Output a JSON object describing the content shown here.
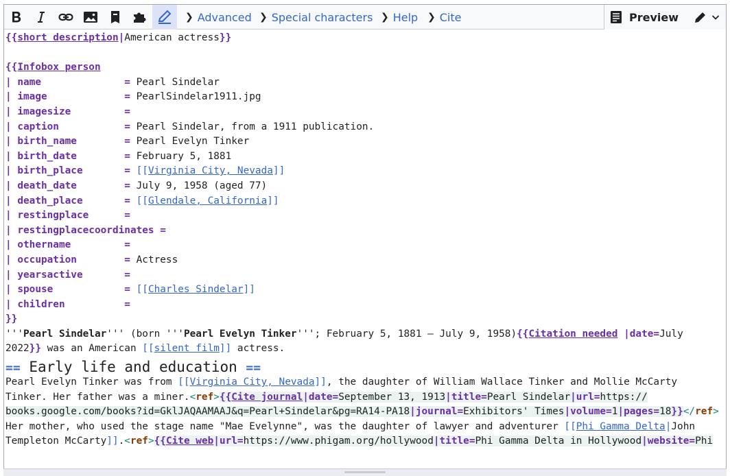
{
  "toolbar": {
    "bold_icon": "bold-icon",
    "italic_icon": "italic-icon",
    "link_icon": "link-icon",
    "image_icon": "image-icon",
    "reference_icon": "reference-icon",
    "puzzle_icon": "puzzle-icon",
    "edit_icon": "pencil-icon",
    "advanced": "Advanced",
    "special_characters": "Special characters",
    "help": "Help",
    "cite": "Cite",
    "preview": "Preview",
    "accent_color": "#3366cc"
  },
  "code": {
    "l1": {
      "open": "{{",
      "name": "short description",
      "pipe": "|",
      "value": "American actress",
      "close": "}}"
    },
    "l3": {
      "open": "{{",
      "name": "Infobox person"
    },
    "params": [
      {
        "key": "| name",
        "pad": "              ",
        "eq": "=",
        "value": " Pearl Sindelar"
      },
      {
        "key": "| image",
        "pad": "             ",
        "eq": "=",
        "value": " PearlSindelar1911.jpg"
      },
      {
        "key": "| imagesize",
        "pad": "         ",
        "eq": "=",
        "value": ""
      },
      {
        "key": "| caption",
        "pad": "           ",
        "eq": "=",
        "value": " Pearl Sindelar, from a 1911 publication."
      },
      {
        "key": "| birth_name",
        "pad": "        ",
        "eq": "=",
        "value": " Pearl Evelyn Tinker"
      },
      {
        "key": "| birth_date",
        "pad": "        ",
        "eq": "=",
        "value": " February 5, 1881"
      }
    ],
    "birth_place": {
      "key": "| birth_place",
      "pad": "       ",
      "eq": "=",
      "lo": "[[",
      "link": "Virginia City, Nevada",
      "lc": "]]"
    },
    "death_date": {
      "key": "| death_date",
      "pad": "        ",
      "eq": "=",
      "value": " July 9, 1958 (aged 77)"
    },
    "death_place": {
      "key": "| death_place",
      "pad": "       ",
      "eq": "=",
      "lo": "[[",
      "link": "Glendale, California",
      "lc": "]]"
    },
    "params2": [
      {
        "key": "| restingplace",
        "pad": "      ",
        "eq": "=",
        "value": ""
      },
      {
        "key": "| restingplacecoordinates",
        "pad": " ",
        "eq": "=",
        "value": ""
      },
      {
        "key": "| othername",
        "pad": "         ",
        "eq": "=",
        "value": ""
      },
      {
        "key": "| occupation",
        "pad": "        ",
        "eq": "=",
        "value": " Actress"
      },
      {
        "key": "| yearsactive",
        "pad": "       ",
        "eq": "=",
        "value": ""
      }
    ],
    "spouse": {
      "key": "| spouse",
      "pad": "            ",
      "eq": "=",
      "lo": "[[",
      "link": "Charles Sindelar",
      "lc": "]]"
    },
    "children": {
      "key": "| children",
      "pad": "          ",
      "eq": "=",
      "value": ""
    },
    "close_infobox": "}}",
    "lead": {
      "q1": "'''",
      "name": "Pearl Sindelar",
      "q2": "''' (born '''",
      "birth": "Pearl Evelyn Tinker",
      "q3": "'''; February 5, 1881 – July 9, 1958)",
      "cn_open": "{{",
      "cn_name": "Citation needed",
      "cn_sp": " ",
      "cn_pipe": "|date=",
      "cn_date": "July",
      "cn_date2": "2022",
      "cn_close": "}}",
      "t1": " was an American ",
      "lo": "[[",
      "link": "silent film",
      "lc": "]]",
      "t2": " actress."
    },
    "heading": {
      "eq1": "==",
      "text": " Early life and education ",
      "eq2": "=="
    },
    "p1": {
      "t1": "Pearl Evelyn Tinker was from ",
      "lo": "[[",
      "link": "Virginia City, Nevada",
      "lc": "]]",
      "t2": ", the daughter of William Wallace Tinker and Mollie McCarty"
    },
    "p2": {
      "t1": "Tinker. Her father was a miner.",
      "ref_open": "<",
      "ref_tag": "ref",
      "ref_gt": ">",
      "c_open": "{{",
      "c_name": "Cite journal",
      "c_p1": "|date=",
      "c_v1": "September 13, 1913",
      "c_p2": "|title=",
      "c_v2": "Pearl Sindelar",
      "c_p3": "|url=",
      "c_v3": "https://"
    },
    "p3": {
      "v": "books.google.com/books?id=GklJAQAAMAAJ&q=Pearl+Sindelar&pg=RA14-PA18",
      "p1": "|journal=",
      "v1": "Exhibitors' Times",
      "p2": "|volume=",
      "v2": "1",
      "p3": "|pages=",
      "v3": "18",
      "close": "}}",
      "rc_open": "</",
      "rc_tag": "ref",
      "rc_gt": ">"
    },
    "p4": {
      "t1": "Her mother, who used the stage name \"Mae Evelynne\", was the daughter of lawyer and adventurer ",
      "lo": "[[",
      "link": "Phi Gamma Delta",
      "pipe": "|",
      "rest": "John"
    },
    "p5": {
      "t1": "Templeton McCarty",
      "lc": "]]",
      "t2": ".",
      "ref_open": "<",
      "ref_tag": "ref",
      "ref_gt": ">",
      "c_open": "{{",
      "c_name": "Cite web",
      "c_p1": "|url=",
      "c_v1": "https://www.phigam.org/hollywood",
      "c_p2": "|title=",
      "c_v2": "Phi Gamma Delta in Hollywood",
      "c_p3": "|website=",
      "c_v3": "Phi"
    }
  }
}
